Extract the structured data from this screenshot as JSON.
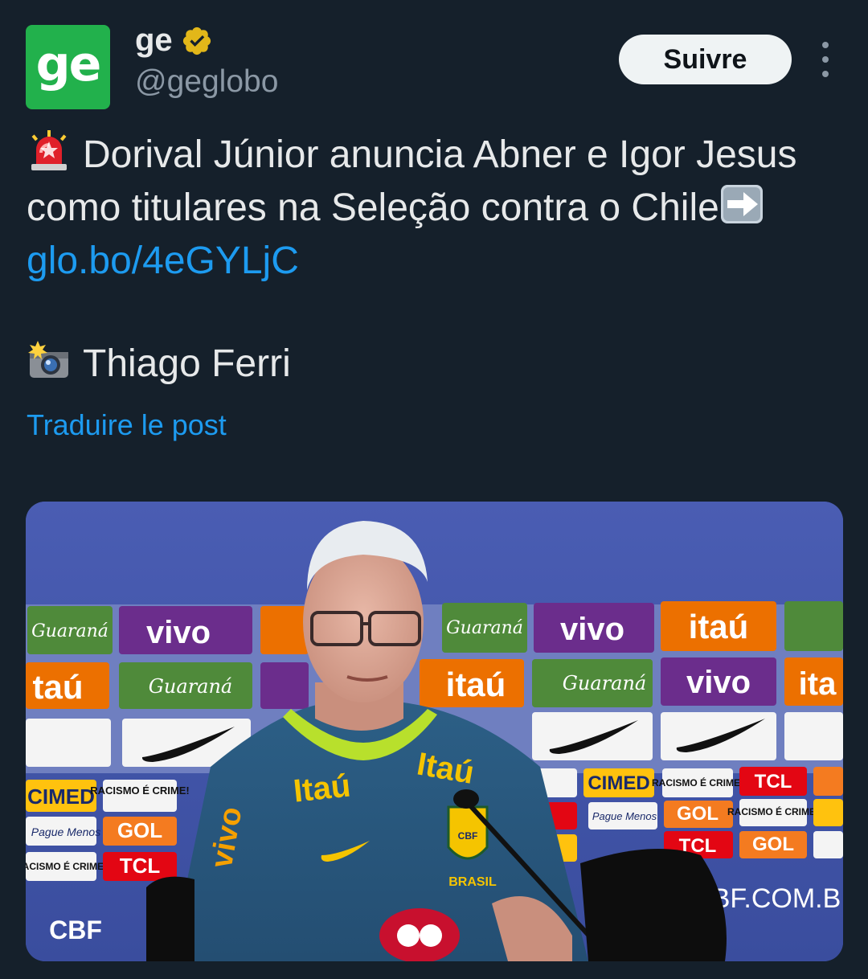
{
  "account": {
    "avatar_text": "ge",
    "display_name": "ge",
    "handle": "@geglobo",
    "verified_icon": "verified-badge-icon"
  },
  "actions": {
    "follow_label": "Suivre",
    "more_icon": "more-options-icon"
  },
  "tweet": {
    "emoji_1": "rotating-light-icon",
    "line1": "Dorival Júnior anuncia Abner e Igor Jesus",
    "line2": "como titulares na Seleção contra o Chile",
    "emoji_2": "right-arrow-icon",
    "link": "glo.bo/4eGYLjC",
    "emoji_3": "camera-flash-icon",
    "credit": "Thiago Ferri",
    "translate_label": "Traduire le post"
  },
  "media": {
    "sponsors": [
      "Guaraná",
      "vivo",
      "itaú",
      "Nike",
      "CIMED",
      "RACISMO É CRIME!",
      "Pague Menos",
      "GOL",
      "TCL",
      "CBF"
    ],
    "shirt_text_1": "Itaú",
    "shirt_text_2": "Itaú",
    "sleeve_text": "vivo",
    "crest_text": "CBF",
    "brasil_text": "BRASIL",
    "site_text": "CBF.COM.BR",
    "cbf_text": "CBF"
  }
}
